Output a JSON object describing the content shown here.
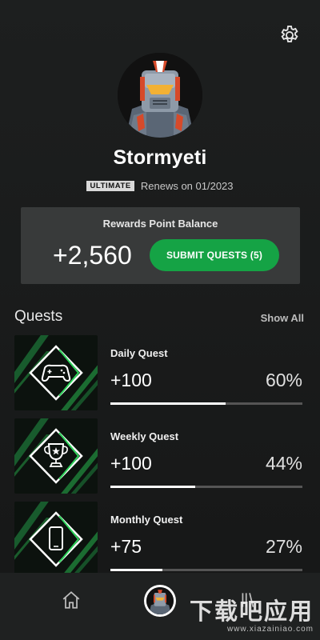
{
  "header": {
    "settings_icon": "gear-icon"
  },
  "profile": {
    "gamertag": "Stormyeti",
    "tier_badge": "ULTIMATE",
    "renews": "Renews on 01/2023",
    "avatar_icon": "robot-avatar"
  },
  "rewards": {
    "title": "Rewards Point Balance",
    "points": "+2,560",
    "submit_label": "SUBMIT QUESTS (5)",
    "accent_color": "#15a345"
  },
  "quests": {
    "title": "Quests",
    "show_all": "Show All",
    "items": [
      {
        "name": "Daily Quest",
        "points": "+100",
        "percent": "60%",
        "progress": 0.6,
        "icon": "gamepad-icon"
      },
      {
        "name": "Weekly Quest",
        "points": "+100",
        "percent": "44%",
        "progress": 0.44,
        "icon": "trophy-icon"
      },
      {
        "name": "Monthly Quest",
        "points": "+75",
        "percent": "27%",
        "progress": 0.27,
        "icon": "phone-icon"
      }
    ]
  },
  "nav": {
    "home_icon": "home-icon",
    "library_icon": "library-icon"
  },
  "watermark": {
    "main": "下载吧应用",
    "sub": "www.xiazainiao.com"
  }
}
